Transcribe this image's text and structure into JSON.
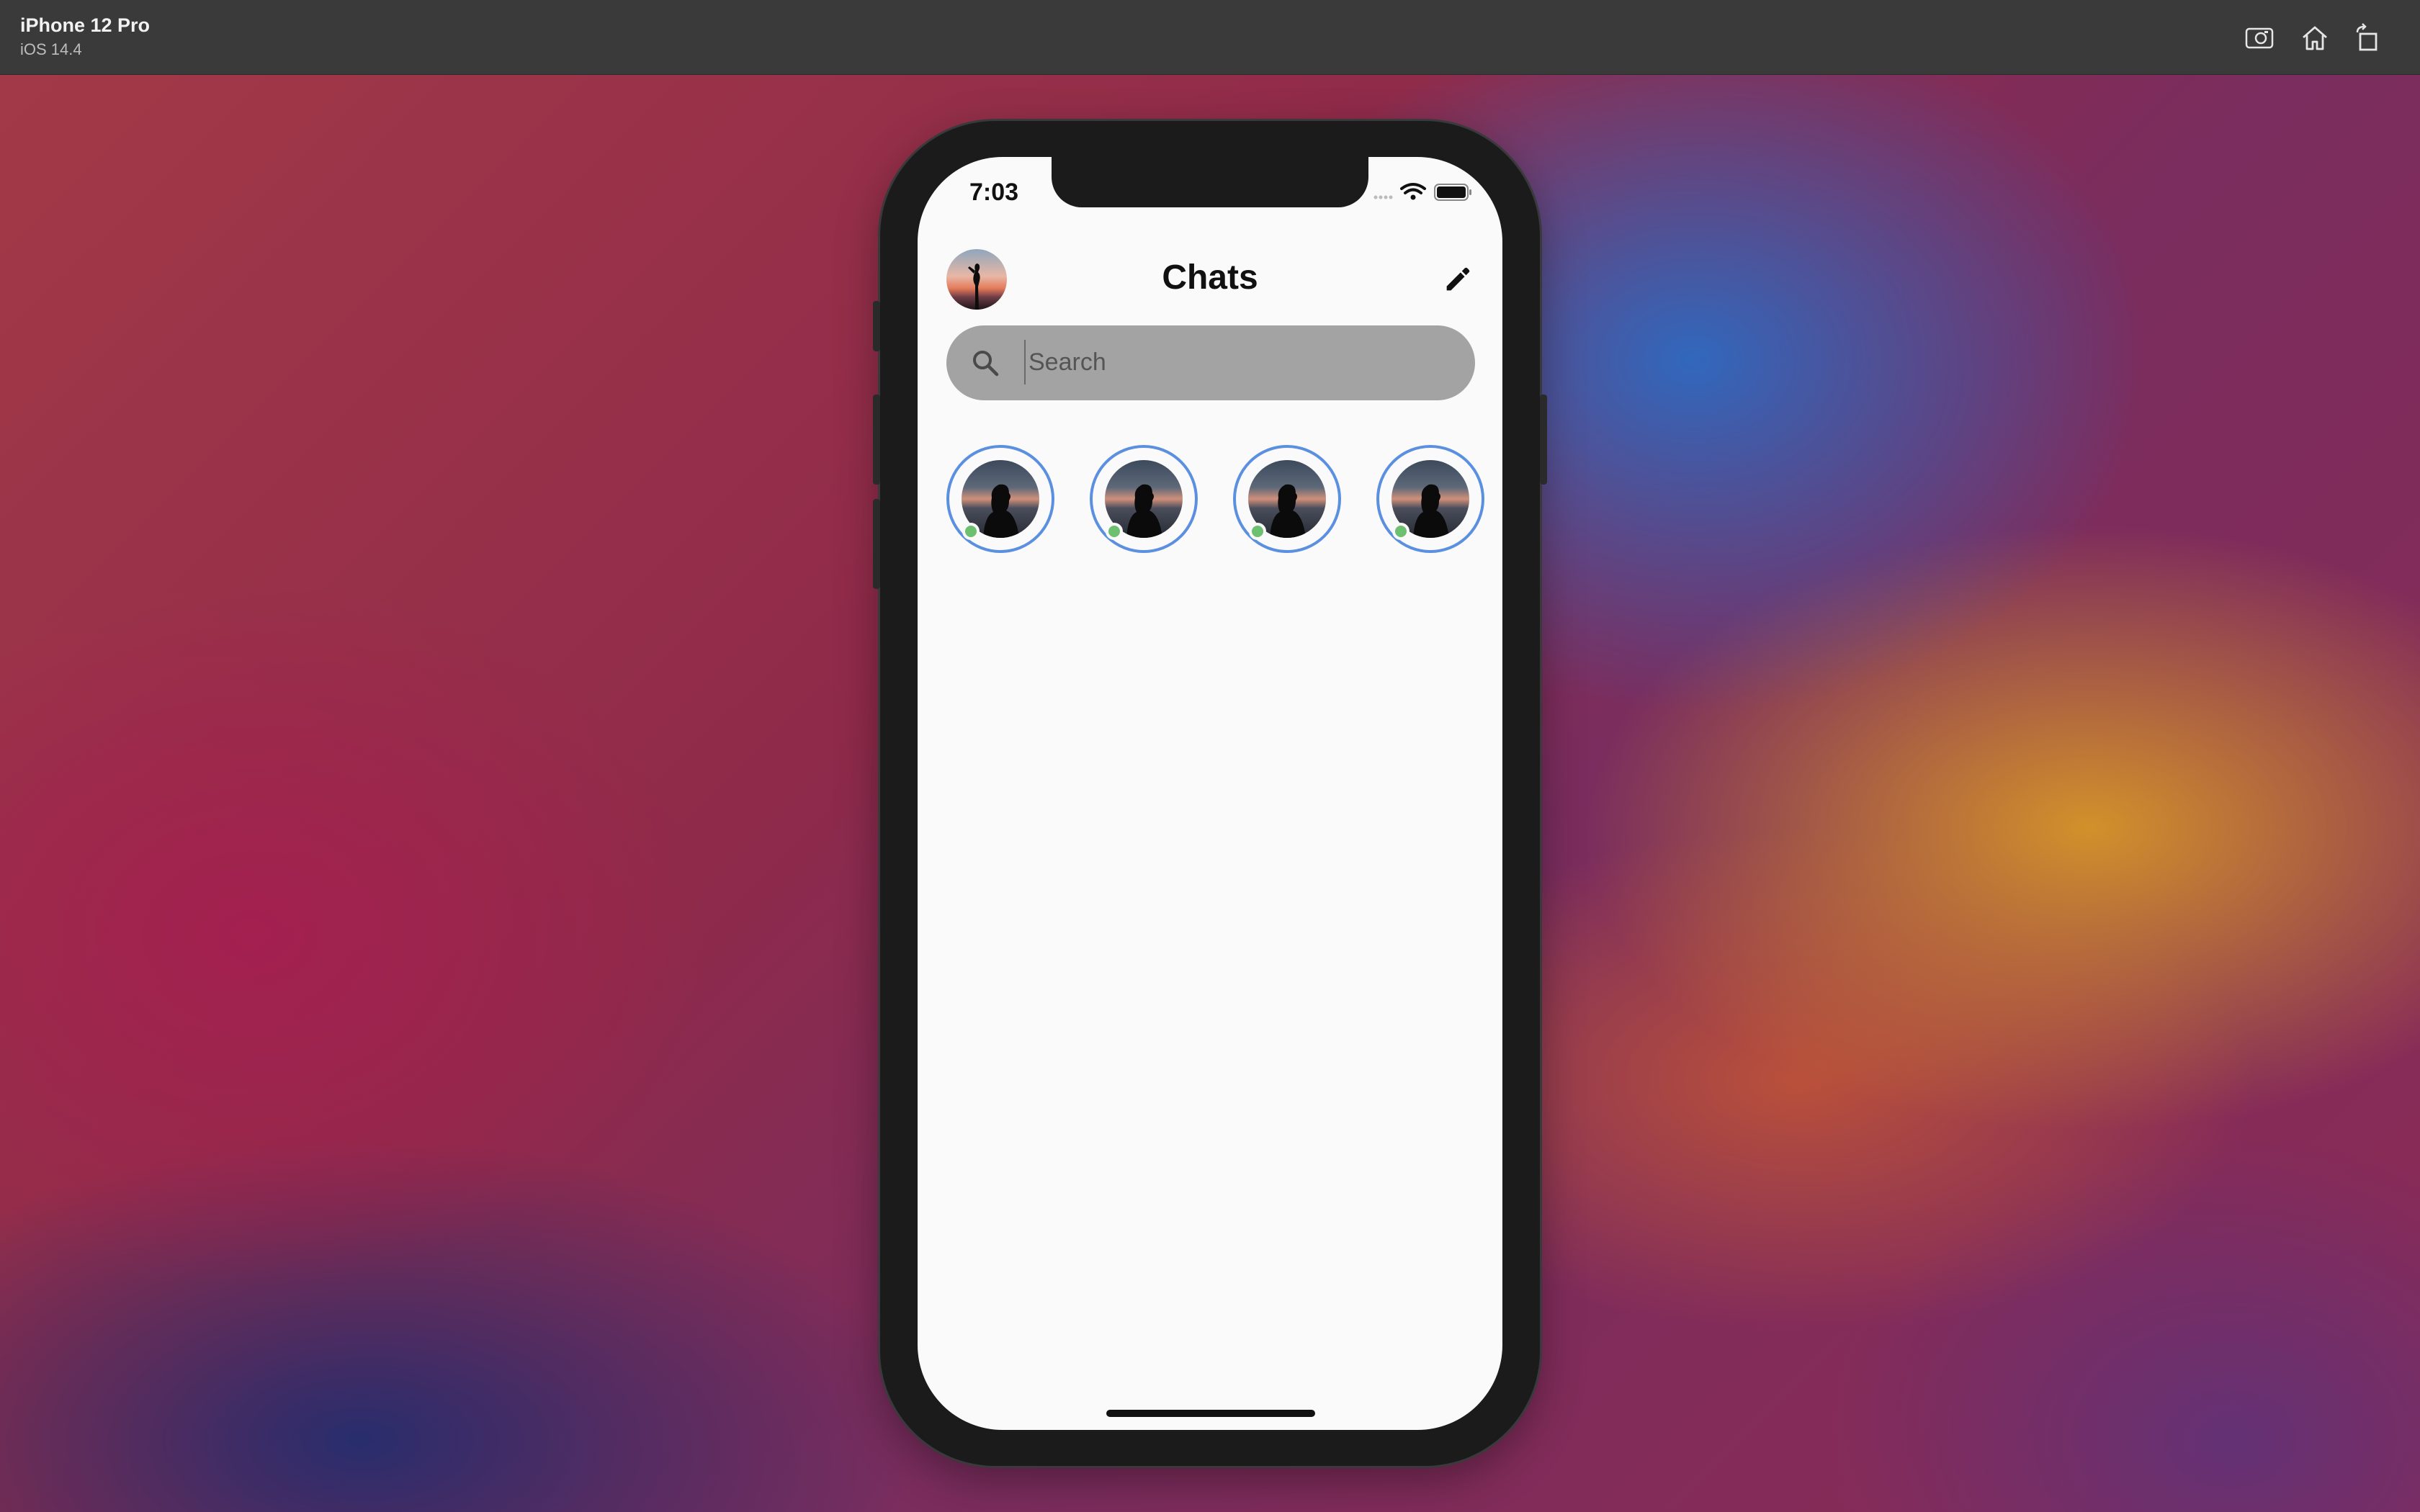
{
  "simulator": {
    "device_name": "iPhone 12 Pro",
    "os_version": "iOS 14.4",
    "buttons": [
      {
        "name": "screenshot-button",
        "icon": "camera-icon"
      },
      {
        "name": "home-button",
        "icon": "home-icon"
      },
      {
        "name": "rotate-button",
        "icon": "rotate-icon"
      }
    ]
  },
  "status_bar": {
    "time": "7:03",
    "icons": [
      "signal-icon",
      "wifi-icon",
      "battery-icon"
    ]
  },
  "header": {
    "title": "Chats",
    "avatar": "profile-avatar",
    "edit_icon": "pencil-icon"
  },
  "search": {
    "placeholder": "Search",
    "value": ""
  },
  "stories": {
    "items": [
      {
        "online": true
      },
      {
        "online": true
      },
      {
        "online": true
      },
      {
        "online": true
      }
    ]
  },
  "colors": {
    "story_ring": "#5b8fe0",
    "online_dot": "#6cc070",
    "search_bg": "#a3a3a3",
    "screen_bg": "#fafafa"
  }
}
